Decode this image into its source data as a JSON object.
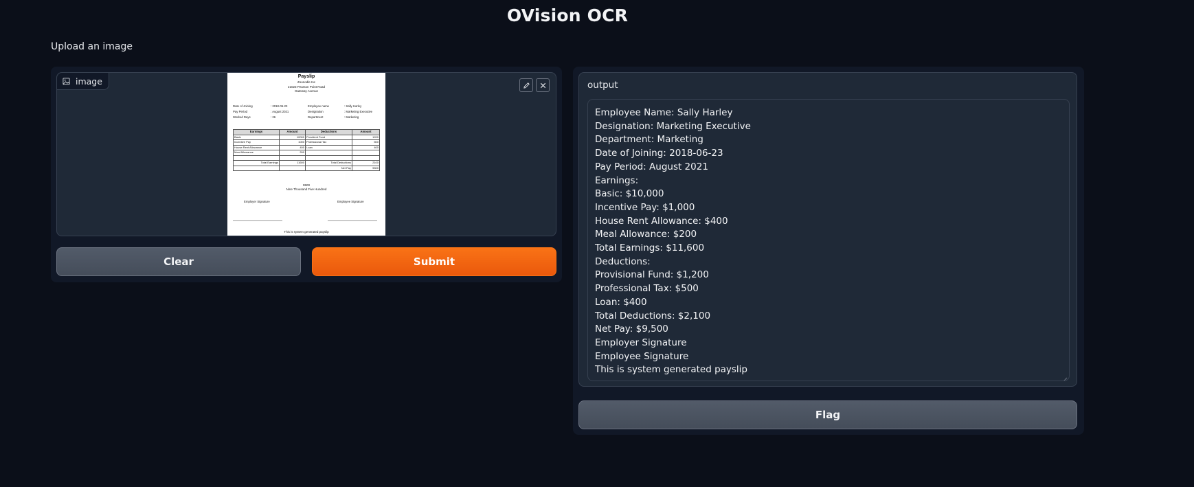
{
  "app": {
    "title": "OVision OCR"
  },
  "input": {
    "label": "Upload an image",
    "image_tag": "image",
    "icons": {
      "tag": "image-icon",
      "edit": "pencil-icon",
      "close": "close-icon"
    }
  },
  "payslip": {
    "title": "Payslip",
    "company": "Zoonodle Inc",
    "address1": "21023 Pearson Point Road",
    "address2": "Gateway Avenue",
    "details_left": [
      {
        "k": "Date of Joining",
        "v": ": 2018-06-23"
      },
      {
        "k": "Pay Period",
        "v": ": August 2021"
      },
      {
        "k": "Worked Days",
        "v": ": 26"
      }
    ],
    "details_right": [
      {
        "k": "Employee name",
        "v": ": Sally Harley"
      },
      {
        "k": "Designation",
        "v": ": Marketing Executive"
      },
      {
        "k": "Department",
        "v": ": Marketing"
      }
    ],
    "table": {
      "headers": [
        "Earnings",
        "Amount",
        "Deductions",
        "Amount"
      ],
      "rows": [
        [
          "Basic",
          "10000",
          "Provident Fund",
          "1200"
        ],
        [
          "Incentive Pay",
          "1000",
          "Professional Tax",
          "500"
        ],
        [
          "House Rent Allowance",
          "400",
          "Loan",
          "400"
        ],
        [
          "Meal Allowance",
          "200",
          "",
          ""
        ],
        [
          "",
          "",
          "",
          ""
        ],
        [
          "Total Earnings",
          "11600",
          "Total Deductions",
          "2100"
        ],
        [
          "",
          "",
          "Net Pay",
          "9500"
        ]
      ]
    },
    "amount": "9500",
    "amount_words": "Nine Thousand Five Hundred",
    "employer_sig": "Employer Signature",
    "employee_sig": "Employee Signature",
    "footer": "This is system generated payslip"
  },
  "buttons": {
    "clear": "Clear",
    "submit": "Submit",
    "flag": "Flag"
  },
  "output": {
    "label": "output",
    "lines": [
      "Employee Name: Sally Harley",
      "Designation: Marketing Executive",
      "Department: Marketing",
      "Date of Joining: 2018-06-23",
      "Pay Period: August 2021",
      "Earnings:",
      "Basic: $10,000",
      "Incentive Pay: $1,000",
      "House Rent Allowance: $400",
      "Meal Allowance: $200",
      "Total Earnings: $11,600",
      "Deductions:",
      "Provisional Fund: $1,200",
      "Professional Tax: $500",
      "Loan: $400",
      "Total Deductions: $2,100",
      "Net Pay: $9,500",
      "Employer Signature",
      "Employee Signature",
      "This is system generated payslip"
    ]
  }
}
